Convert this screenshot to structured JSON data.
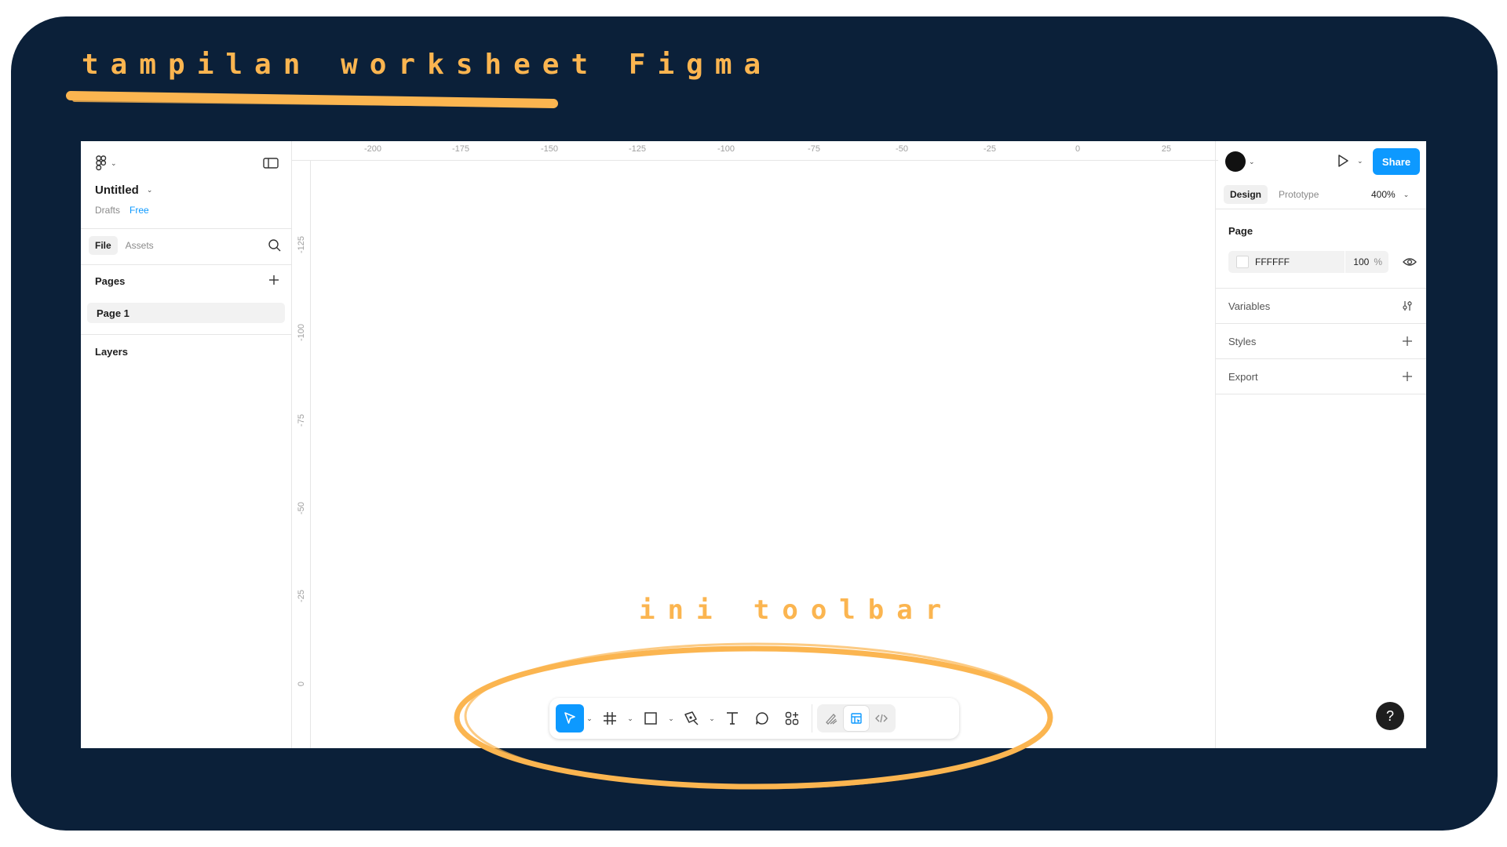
{
  "annotations": {
    "title": "tampilan worksheet Figma",
    "toolbar_note": "ini toolbar",
    "accent_color": "#fbb550",
    "background_color": "#0b2039"
  },
  "left_panel": {
    "file_name": "Untitled",
    "location": "Drafts",
    "plan": "Free",
    "tabs": [
      "File",
      "Assets"
    ],
    "pages_label": "Pages",
    "pages": [
      "Page 1"
    ],
    "layers_label": "Layers"
  },
  "rulers": {
    "top": [
      "-200",
      "-175",
      "-150",
      "-125",
      "-100",
      "-75",
      "-50",
      "-25",
      "0",
      "25"
    ],
    "left": [
      "-125",
      "-100",
      "-75",
      "-50",
      "-25",
      "0"
    ]
  },
  "toolbar": {
    "tools": [
      "move-icon",
      "frame-icon",
      "rectangle-icon",
      "pen-icon",
      "text-icon",
      "comment-icon",
      "actions-icon"
    ],
    "modes": [
      "draw-mode-icon",
      "design-mode-icon",
      "dev-mode-icon"
    ],
    "active_tool": "move-icon",
    "active_mode": "design-mode-icon"
  },
  "right_panel": {
    "tabs": [
      "Design",
      "Prototype"
    ],
    "zoom": "400%",
    "share_label": "Share",
    "page_label": "Page",
    "page_color": "FFFFFF",
    "page_opacity": "100",
    "opacity_unit": "%",
    "sections": [
      "Variables",
      "Styles",
      "Export"
    ]
  },
  "help_label": "?"
}
